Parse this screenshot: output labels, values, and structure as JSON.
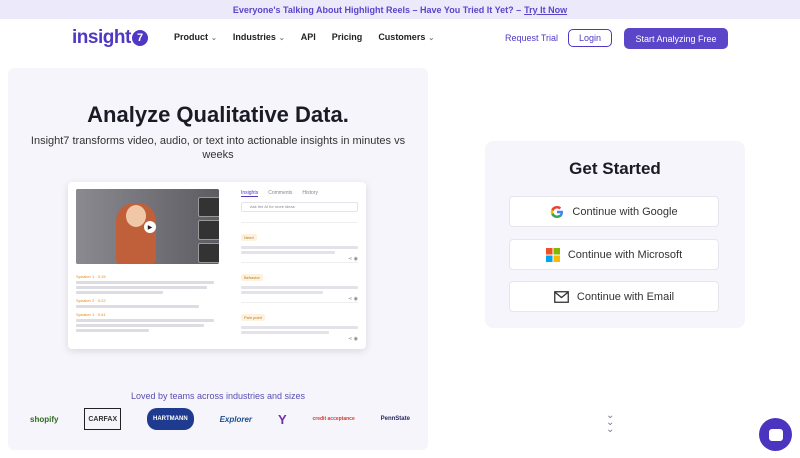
{
  "announcement": {
    "text": "Everyone's Talking About Highlight Reels – Have You Tried It Yet? –",
    "link": "Try It Now"
  },
  "nav": {
    "logo_text": "insight",
    "logo_mark": "7",
    "items": [
      {
        "label": "Product",
        "has_dropdown": true
      },
      {
        "label": "Industries",
        "has_dropdown": true
      },
      {
        "label": "API",
        "has_dropdown": false
      },
      {
        "label": "Pricing",
        "has_dropdown": false
      },
      {
        "label": "Customers",
        "has_dropdown": true
      }
    ],
    "request_trial": "Request Trial",
    "login": "Login",
    "cta": "Start Analyzing Free"
  },
  "hero": {
    "title": "Analyze Qualitative Data.",
    "subtitle": "Insight7 transforms video, audio, or text into actionable insights in minutes vs weeks",
    "loved_by": "Loved by teams across industries and sizes",
    "customer_logos": [
      "shopify",
      "CARFAX",
      "HARTMANN",
      "Explorer",
      "Y",
      "credit acceptance",
      "PennState"
    ]
  },
  "product_mock": {
    "tabs": [
      "Insights",
      "Comments",
      "History"
    ],
    "search_placeholder": "Ask the AI for more ideas",
    "speakers": [
      "Speaker 1 · 0:15",
      "Speaker 2 · 0:22",
      "Speaker 1 · 0:41"
    ],
    "cards": [
      {
        "tag": "Need"
      },
      {
        "tag": "Behavior"
      },
      {
        "tag": "Pain point"
      }
    ]
  },
  "get_started": {
    "title": "Get Started",
    "google": "Continue with Google",
    "microsoft": "Continue with Microsoft",
    "email": "Continue with Email"
  },
  "colors": {
    "brand": "#5b45c9",
    "announce_bg": "#ece9fb",
    "panel_bg": "#f6f5fb"
  },
  "icons": [
    "google-icon",
    "microsoft-icon",
    "mail-icon",
    "chevrons-down-icon",
    "chat-icon"
  ]
}
